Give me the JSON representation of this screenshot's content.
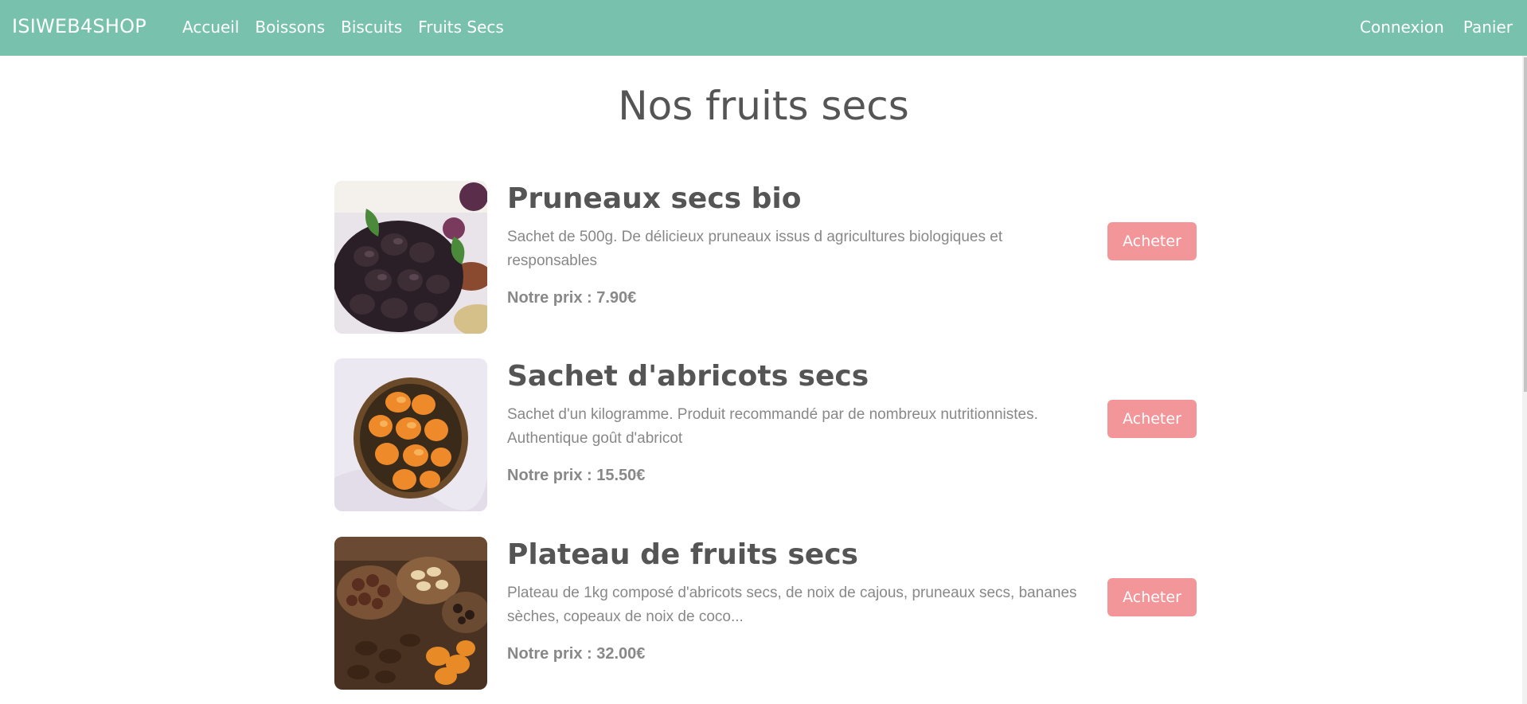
{
  "navbar": {
    "brand": "ISIWEB4SHOP",
    "links": [
      "Accueil",
      "Boissons",
      "Biscuits",
      "Fruits Secs"
    ],
    "right_links": [
      "Connexion",
      "Panier"
    ],
    "background": "#78c2ad"
  },
  "page": {
    "title": "Nos fruits secs"
  },
  "products": [
    {
      "title": "Pruneaux secs bio",
      "description": "Sachet de 500g. De délicieux pruneaux issus d agricultures biologiques et responsables",
      "price_label": "Notre prix : ",
      "price": "7.90€",
      "button": "Acheter",
      "image_icon": "prunes-photo"
    },
    {
      "title": "Sachet d'abricots secs",
      "description": "Sachet d'un kilogramme. Produit recommandé par de nombreux nutritionnistes. Authentique goût d'abricot",
      "price_label": "Notre prix : ",
      "price": "15.50€",
      "button": "Acheter",
      "image_icon": "apricots-photo"
    },
    {
      "title": "Plateau de fruits secs",
      "description": "Plateau de 1kg composé d'abricots secs, de noix de cajous, pruneaux secs, bananes sèches, copeaux de noix de coco...",
      "price_label": "Notre prix : ",
      "price": "32.00€",
      "button": "Acheter",
      "image_icon": "dried-fruit-platter-photo"
    }
  ],
  "colors": {
    "accent": "#78c2ad",
    "button": "#f3969a",
    "text": "#555555",
    "muted": "#888888"
  }
}
